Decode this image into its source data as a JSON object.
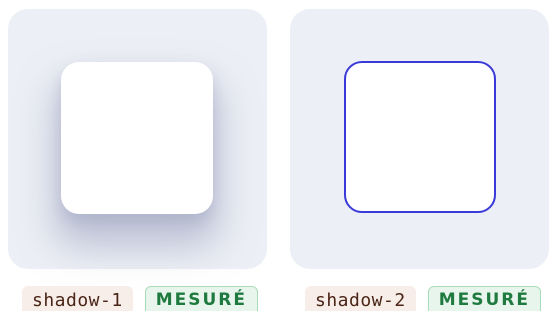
{
  "items": [
    {
      "name": "shadow-1",
      "status": "MESURÉ"
    },
    {
      "name": "shadow-2",
      "status": "MESURÉ"
    }
  ],
  "colors": {
    "panel_background": "#eceff5",
    "card_background": "#ffffff",
    "outline_stroke": "#3a3ad9",
    "name_tag_background": "#f7eee9",
    "status_tag_text": "#1f7a40"
  }
}
